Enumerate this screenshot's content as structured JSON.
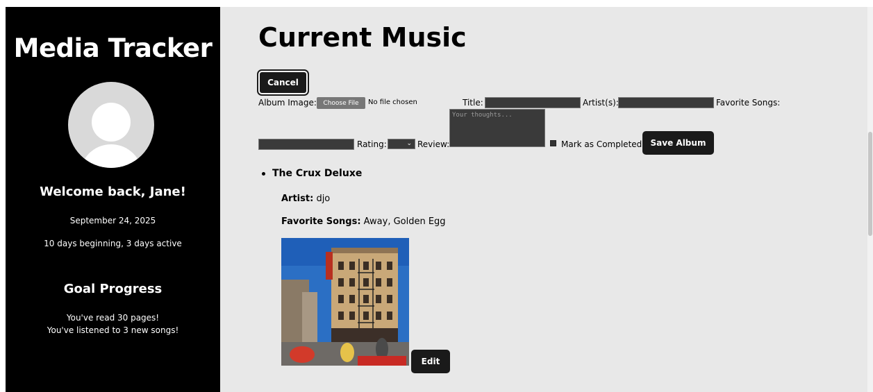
{
  "sidebar": {
    "app_title": "Media Tracker",
    "welcome": "Welcome back, Jane!",
    "date": "September 24, 2025",
    "streak": "10 days beginning, 3 days active",
    "goal_title": "Goal Progress",
    "goals": [
      "You've read 30 pages!",
      "You've listened to 3 new songs!"
    ]
  },
  "main": {
    "page_title": "Current Music",
    "cancel_label": "Cancel",
    "form": {
      "album_image_label": "Album Image:",
      "choose_file_label": "Choose File",
      "no_file_text": "No file chosen",
      "title_label": "Title:",
      "artist_label": "Artist(s):",
      "favorite_songs_label": "Favorite Songs:",
      "rating_label": "Rating:",
      "review_label": "Review:",
      "review_placeholder": "Your thoughts...",
      "mark_completed_label": "Mark as Completed",
      "save_label": "Save Album"
    },
    "album": {
      "title": "The Crux Deluxe",
      "artist_label": "Artist:",
      "artist": "djo",
      "favorite_songs_label": "Favorite Songs:",
      "favorite_songs": "Away, Golden Egg",
      "edit_label": "Edit"
    }
  },
  "colors": {
    "sidebar_bg": "#000000",
    "main_bg": "#e8e8e8",
    "button_bg": "#1a1a1a",
    "input_bg": "#3a3a3a"
  }
}
